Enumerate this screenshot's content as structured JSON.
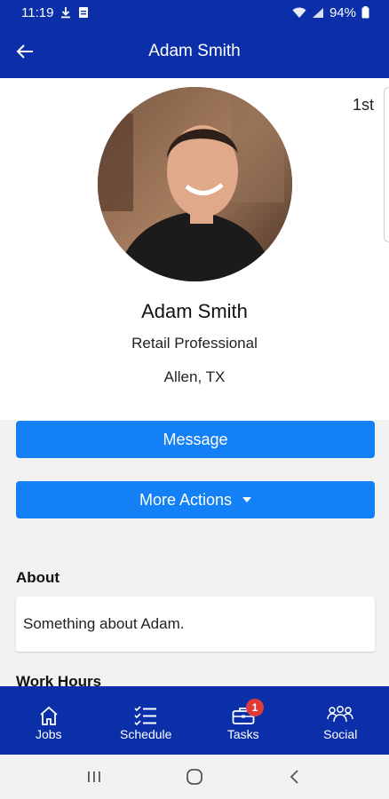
{
  "status_bar": {
    "time": "11:19",
    "battery": "94%"
  },
  "header": {
    "title": "Adam Smith"
  },
  "profile": {
    "degree": "1st",
    "name": "Adam Smith",
    "role": "Retail Professional",
    "location": "Allen, TX"
  },
  "actions": {
    "message_label": "Message",
    "more_actions_label": "More Actions"
  },
  "about": {
    "heading": "About",
    "text": "Something about Adam."
  },
  "work_hours": {
    "heading": "Work Hours"
  },
  "bottom_nav": {
    "items": [
      {
        "label": "Jobs",
        "icon": "home-icon"
      },
      {
        "label": "Schedule",
        "icon": "checklist-icon"
      },
      {
        "label": "Tasks",
        "icon": "briefcase-icon",
        "badge": "1"
      },
      {
        "label": "Social",
        "icon": "people-icon"
      }
    ]
  },
  "colors": {
    "primary": "#0a2fa8",
    "button": "#1480f5",
    "badge": "#e03a3a"
  }
}
